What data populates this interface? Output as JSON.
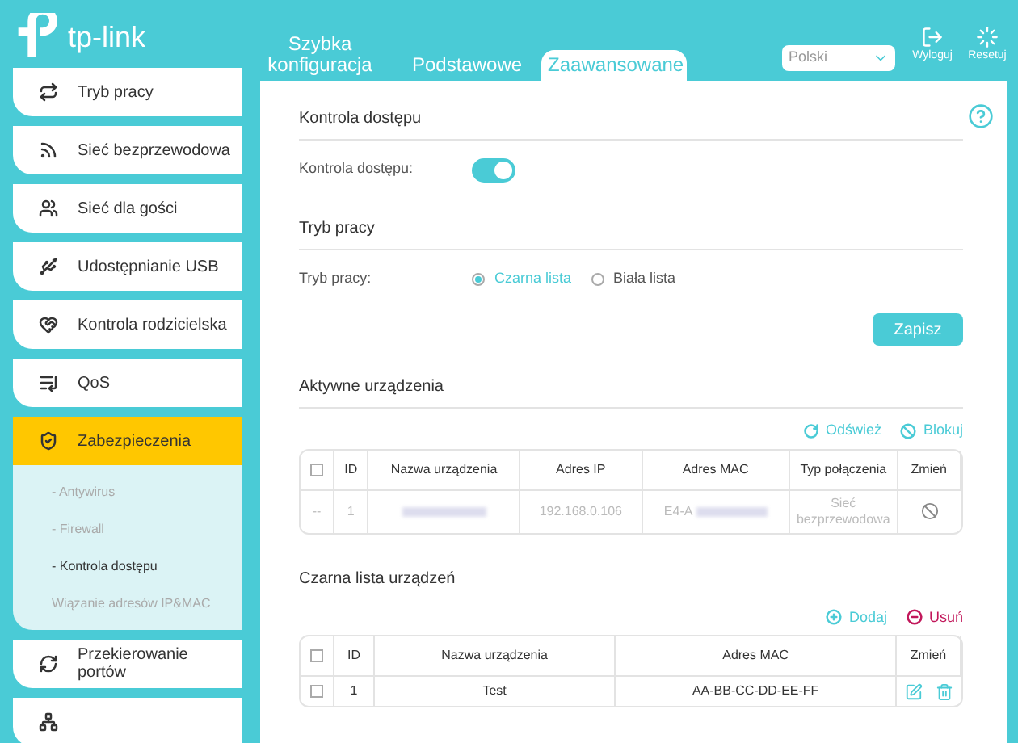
{
  "header": {
    "brand": "tp-link",
    "tabs": [
      {
        "label": "Szybka konfiguracja",
        "selected": false
      },
      {
        "label": "Podstawowe",
        "selected": false
      },
      {
        "label": "Zaawansowane",
        "selected": true
      }
    ],
    "language": "Polski",
    "actions": [
      {
        "kind": "logout",
        "label": "Wyloguj"
      },
      {
        "kind": "reset",
        "label": "Resetuj"
      }
    ]
  },
  "sidebar": {
    "items": [
      {
        "label": "Tryb pracy",
        "selected": false
      },
      {
        "label": "Sieć bezprzewodowa",
        "selected": false
      },
      {
        "label": "Sieć dla gości",
        "selected": false
      },
      {
        "label": "Udostępnianie USB",
        "selected": false
      },
      {
        "label": "Kontrola rodzicielska",
        "selected": false
      },
      {
        "label": "QoS",
        "selected": false
      },
      {
        "label": "Zabezpieczenia",
        "selected": true,
        "children": [
          {
            "label": "- Antywirus",
            "selected": false
          },
          {
            "label": "- Firewall",
            "selected": false
          },
          {
            "label": "- Kontrola dostępu",
            "selected": true
          },
          {
            "label": "Wiązanie adresów IP&MAC",
            "selected": false
          }
        ]
      },
      {
        "label": "Przekierowanie portów",
        "selected": false
      },
      {
        "selected": false
      }
    ]
  },
  "access_control": {
    "title": "Kontrola dostępu",
    "label": "Kontrola dostępu:",
    "on": true
  },
  "mode": {
    "title": "Tryb pracy",
    "label": "Tryb pracy:",
    "options": [
      {
        "label": "Czarna lista",
        "selected": true
      },
      {
        "label": "Biała lista",
        "selected": false
      }
    ],
    "save": "Zapisz"
  },
  "active_devices": {
    "title": "Aktywne urządzenia",
    "actions": [
      {
        "kind": "refresh",
        "label": "Odśwież"
      },
      {
        "kind": "block",
        "label": "Blokuj"
      }
    ],
    "all_checked": false,
    "columns": [
      "ID",
      "Nazwa urządzenia",
      "Adres IP",
      "Adres MAC",
      "Typ połączenia",
      "Zmień"
    ],
    "rows": [
      {
        "checkbox": "--",
        "id": "1",
        "ip": "192.168.0.106",
        "mac_prefix": "E4-A",
        "connection": "Sieć bezprzewodowa"
      }
    ]
  },
  "blacklist": {
    "title": "Czarna lista urządzeń",
    "actions": [
      {
        "kind": "add",
        "label": "Dodaj"
      },
      {
        "kind": "remove",
        "label": "Usuń"
      }
    ],
    "all_checked": false,
    "columns": [
      "ID",
      "Nazwa urządzenia",
      "Adres MAC",
      "Zmień"
    ],
    "rows": [
      {
        "checked": false,
        "id": "1",
        "name": "Test",
        "mac": "AA-BB-CC-DD-EE-FF"
      }
    ]
  }
}
